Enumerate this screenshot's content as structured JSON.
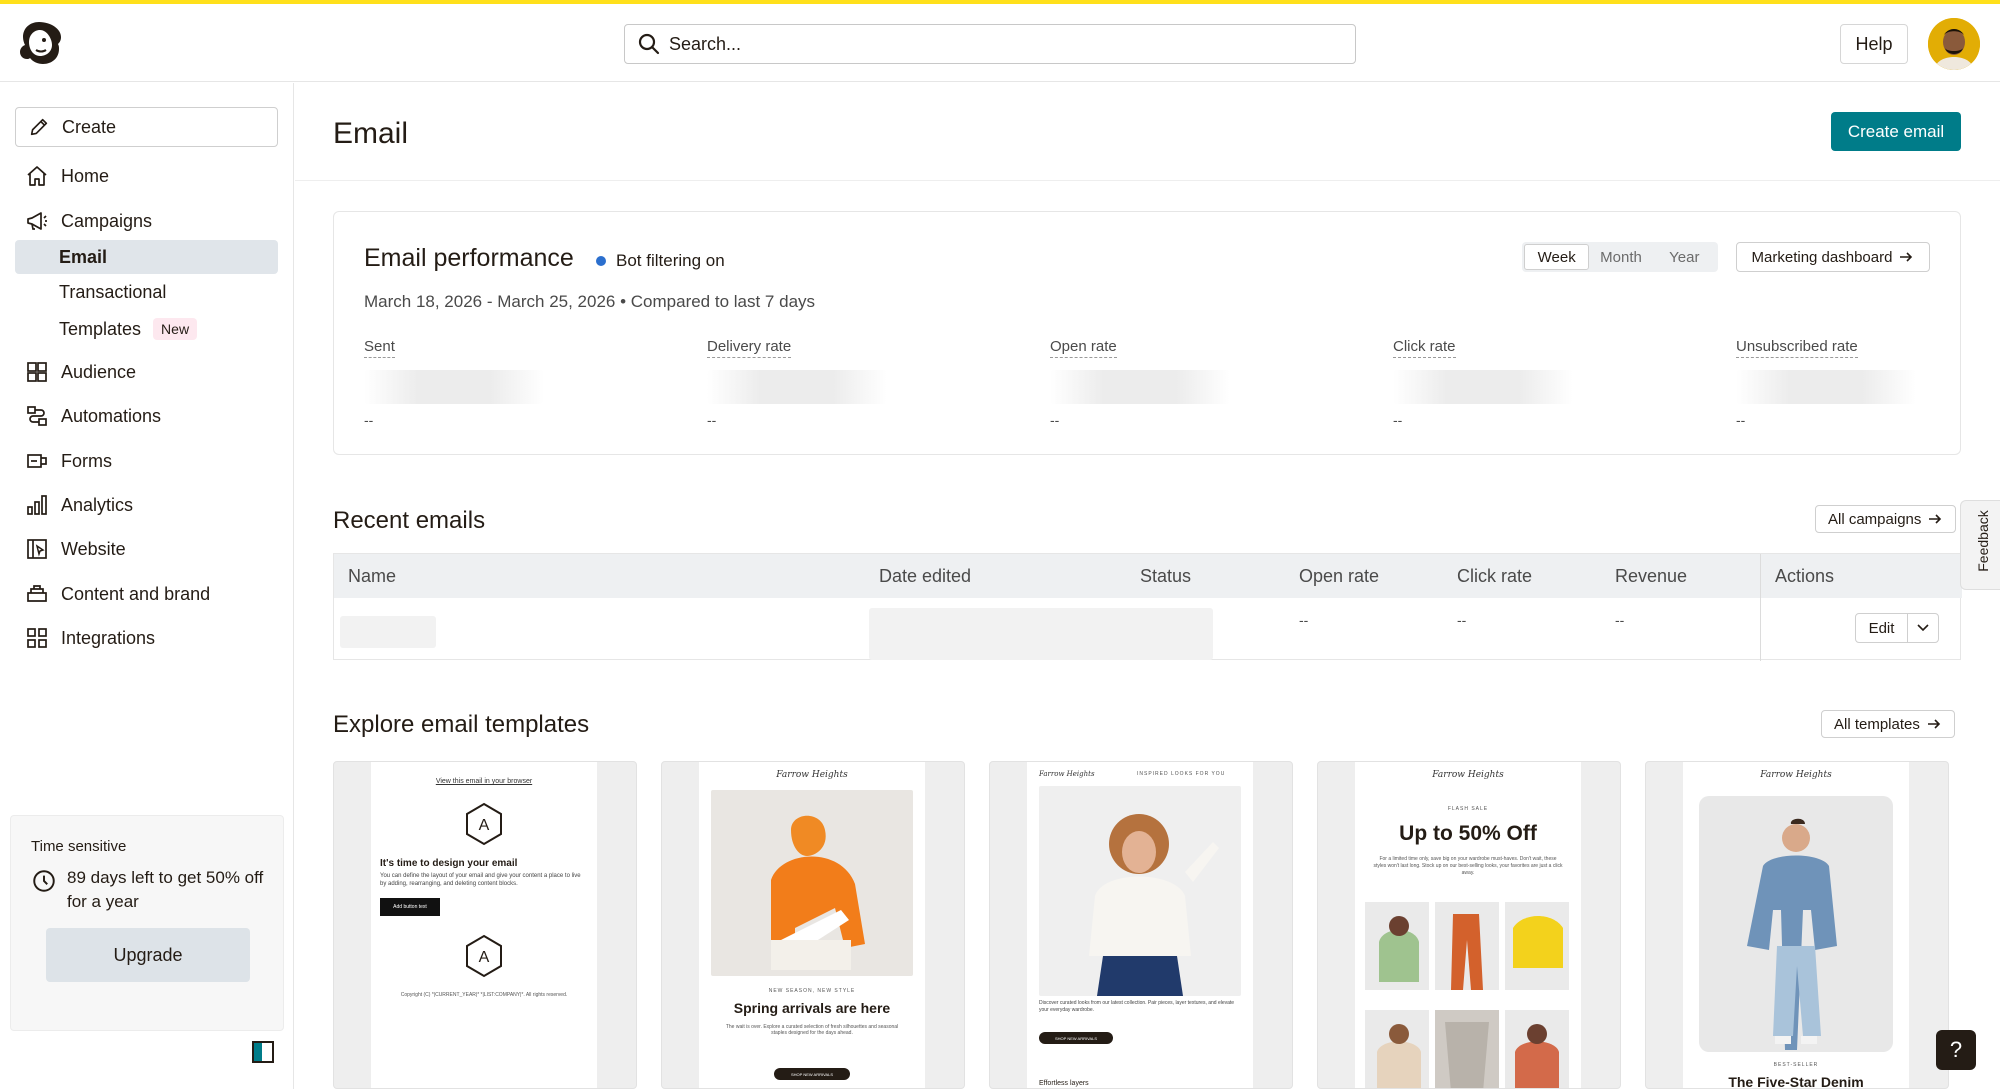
{
  "search": {
    "placeholder": "Search..."
  },
  "header": {
    "help_label": "Help"
  },
  "sidebar": {
    "create_label": "Create",
    "items": [
      {
        "label": "Home",
        "icon": "home-icon"
      },
      {
        "label": "Campaigns",
        "icon": "megaphone-icon"
      },
      {
        "label": "Audience",
        "icon": "audience-icon"
      },
      {
        "label": "Automations",
        "icon": "automations-icon"
      },
      {
        "label": "Forms",
        "icon": "forms-icon"
      },
      {
        "label": "Analytics",
        "icon": "bar-chart-icon"
      },
      {
        "label": "Website",
        "icon": "website-icon"
      },
      {
        "label": "Content and brand",
        "icon": "content-icon"
      },
      {
        "label": "Integrations",
        "icon": "grid-icon"
      }
    ],
    "campaign_sub": [
      {
        "label": "Email",
        "active": true
      },
      {
        "label": "Transactional"
      },
      {
        "label": "Templates",
        "badge": "New"
      }
    ],
    "promo": {
      "heading": "Time sensitive",
      "message": "89 days left to get 50% off for a year",
      "button": "Upgrade"
    }
  },
  "main": {
    "title": "Email",
    "create_button": "Create email",
    "performance": {
      "title": "Email performance",
      "bot_filter": "Bot filtering on",
      "date_range": "March 18, 2026 - March 25, 2026 • Compared to last 7 days",
      "periods": [
        "Week",
        "Month",
        "Year"
      ],
      "selected_period": "Week",
      "dashboard_button": "Marketing dashboard",
      "metrics": [
        {
          "label": "Sent",
          "value": "--"
        },
        {
          "label": "Delivery rate",
          "value": "--"
        },
        {
          "label": "Open rate",
          "value": "--"
        },
        {
          "label": "Click rate",
          "value": "--"
        },
        {
          "label": "Unsubscribed rate",
          "value": "--"
        }
      ]
    },
    "recent": {
      "title": "Recent emails",
      "all_button": "All campaigns",
      "columns": [
        "Name",
        "Date edited",
        "Status",
        "Open rate",
        "Click rate",
        "Revenue",
        "Actions"
      ],
      "row": {
        "open_rate": "--",
        "click_rate": "--",
        "revenue": "--",
        "edit_label": "Edit"
      }
    },
    "templates": {
      "title": "Explore email templates",
      "all_button": "All templates",
      "cards": [
        {
          "top_link": "View this email in your browser",
          "heading": "It's time to design your email",
          "body": "You can define the layout of your email and give your content a place to live by adding, rearranging, and deleting content blocks.",
          "button": "Add button text",
          "footer": "Copyright (C) *|CURRENT_YEAR|* *|LIST:COMPANY|*. All rights reserved."
        },
        {
          "brand": "Farrow Heights",
          "eyebrow": "NEW SEASON, NEW STYLE",
          "heading": "Spring arrivals are here",
          "body": "The wait is over. Explore a curated selection of fresh silhouettes and seasonal staples designed for the days ahead.",
          "button": "SHOP NEW ARRIVALS"
        },
        {
          "brand": "Farrow Heights",
          "tagline": "INSPIRED LOOKS FOR YOU",
          "body": "Discover curated looks from our latest collection. Pair pieces, layer textures, and elevate your everyday wardrobe.",
          "button": "SHOP NEW ARRIVALS",
          "caption": "Effortless layers"
        },
        {
          "brand": "Farrow Heights",
          "eyebrow": "FLASH SALE",
          "heading": "Up to 50% Off",
          "body": "For a limited time only, save big on your wardrobe must-haves. Don't wait, these styles won't last long. Stock up on our best-selling looks, your favorites are just a click away."
        },
        {
          "brand": "Farrow Heights",
          "eyebrow": "BEST-SELLER",
          "heading": "The Five-Star Denim"
        }
      ]
    }
  },
  "feedback_label": "Feedback",
  "help_fab": "?",
  "colors": {
    "accent": "#007c89",
    "brand_yellow": "#ffe01b",
    "active_nav": "#e0e5ea"
  }
}
